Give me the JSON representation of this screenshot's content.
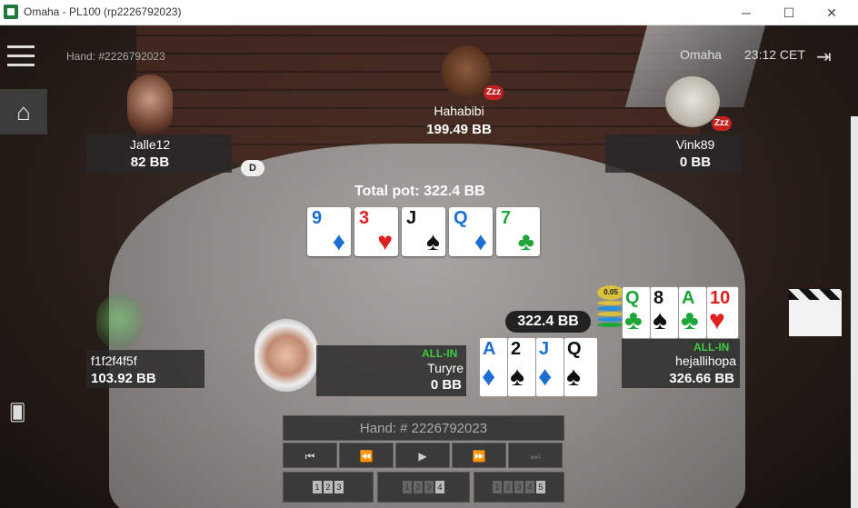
{
  "window": {
    "title": "Omaha - PL100 (rp2226792023)",
    "minimize": "─",
    "maximize": "☐",
    "close": "✕"
  },
  "header": {
    "hand_label": "Hand: #2226792023",
    "game_type": "Omaha",
    "clock": "23:12 CET"
  },
  "table": {
    "dealer_button": "D",
    "total_pot": "Total pot: 322.4 BB",
    "pot_amount": "322.4 BB",
    "chip_label": "0.05",
    "board": [
      {
        "rank": "9",
        "suit": "♦",
        "color": "#1a6fd1"
      },
      {
        "rank": "3",
        "suit": "♥",
        "color": "#e02020"
      },
      {
        "rank": "J",
        "suit": "♠",
        "color": "#111111"
      },
      {
        "rank": "Q",
        "suit": "♦",
        "color": "#1a6fd1"
      },
      {
        "rank": "7",
        "suit": "♣",
        "color": "#1ea53a"
      }
    ]
  },
  "players": {
    "hahabibi": {
      "name": "Hahabibi",
      "stack": "199.49 BB",
      "status": "Zzz"
    },
    "jalle12": {
      "name": "Jalle12",
      "stack": "82 BB"
    },
    "vink89": {
      "name": "Vink89",
      "stack": "0 BB",
      "status": "Zzz"
    },
    "f1f2f4f5f": {
      "name": "f1f2f4f5f",
      "stack": "103.92 BB"
    },
    "turyre": {
      "name": "Turyre",
      "stack": "0 BB",
      "badge": "ALL-IN",
      "cards": [
        {
          "rank": "A",
          "suit": "♦",
          "color": "#1a6fd1"
        },
        {
          "rank": "2",
          "suit": "♠",
          "color": "#111111"
        },
        {
          "rank": "J",
          "suit": "♦",
          "color": "#1a6fd1"
        },
        {
          "rank": "Q",
          "suit": "♠",
          "color": "#111111"
        }
      ]
    },
    "hejallihopa": {
      "name": "hejallihopa",
      "stack": "326.66 BB",
      "badge": "ALL-IN",
      "cards": [
        {
          "rank": "Q",
          "suit": "♣",
          "color": "#1ea53a"
        },
        {
          "rank": "8",
          "suit": "♠",
          "color": "#111111"
        },
        {
          "rank": "A",
          "suit": "♣",
          "color": "#1ea53a"
        },
        {
          "rank": "10",
          "suit": "♥",
          "color": "#e02020"
        }
      ]
    }
  },
  "replay": {
    "hand_label": "Hand: # 2226792023",
    "buttons": [
      "⏮",
      "⏪",
      "▶",
      "⏩",
      "⏭"
    ],
    "streets": [
      {
        "digits": [
          "1",
          "2",
          "3"
        ]
      },
      {
        "digits": [
          "1",
          "2",
          "3",
          "4"
        ]
      },
      {
        "digits": [
          "1",
          "2",
          "3",
          "4",
          "5"
        ]
      }
    ]
  },
  "icons": {
    "menu": "hamburger-menu-icon",
    "home": "home-icon",
    "exit": "exit-icon",
    "cards": "cards-icon"
  }
}
